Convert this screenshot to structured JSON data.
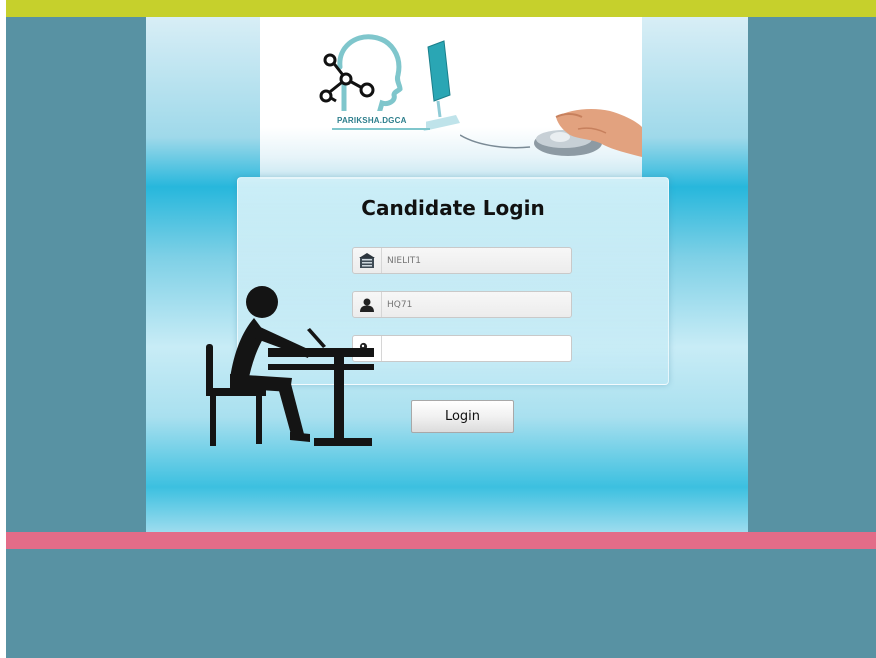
{
  "header": {
    "logo_text": "PARIKSHA.DGCA"
  },
  "login": {
    "title": "Candidate Login",
    "centre_field": {
      "placeholder": "NIELIT1",
      "value": "",
      "icon": "building-icon"
    },
    "user_field": {
      "placeholder": "HQ71",
      "value": "",
      "icon": "user-icon"
    },
    "password_field": {
      "placeholder": "",
      "value": "",
      "icon": "key-icon"
    },
    "button_label": "Login"
  },
  "colors": {
    "top_bar": "#c6d02c",
    "bottom_bar": "#e36c88",
    "page_background": "#5892a3",
    "panel_accent": "#27b7dc",
    "logo_teal": "#2d7e8c"
  }
}
